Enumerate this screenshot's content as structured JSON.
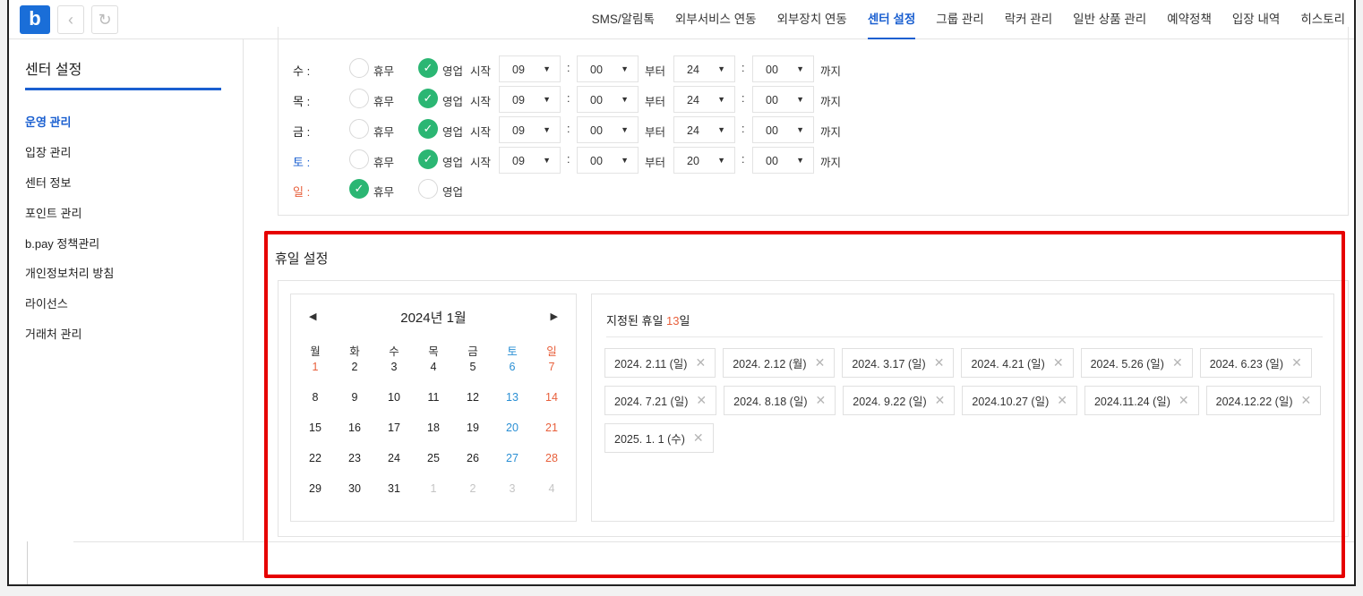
{
  "topbar": {
    "logo": "b",
    "back_icon": "‹",
    "refresh_icon": "↻",
    "menu": [
      {
        "label": "SMS/알림톡",
        "active": false
      },
      {
        "label": "외부서비스 연동",
        "active": false
      },
      {
        "label": "외부장치 연동",
        "active": false
      },
      {
        "label": "센터 설정",
        "active": true
      },
      {
        "label": "그룹 관리",
        "active": false
      },
      {
        "label": "락커 관리",
        "active": false
      },
      {
        "label": "일반 상품 관리",
        "active": false
      },
      {
        "label": "예약정책",
        "active": false
      },
      {
        "label": "입장 내역",
        "active": false
      },
      {
        "label": "히스토리",
        "active": false
      }
    ]
  },
  "sidebar": {
    "title": "센터 설정",
    "items": [
      {
        "label": "운영 관리",
        "active": true
      },
      {
        "label": "입장 관리",
        "active": false
      },
      {
        "label": "센터 정보",
        "active": false
      },
      {
        "label": "포인트 관리",
        "active": false
      },
      {
        "label": "b.pay 정책관리",
        "active": false
      },
      {
        "label": "개인정보처리 방침",
        "active": false
      },
      {
        "label": "라이선스",
        "active": false
      },
      {
        "label": "거래처 관리",
        "active": false
      }
    ]
  },
  "hours": {
    "closed_label": "휴무",
    "open_label": "영업",
    "start_label": "시작",
    "from_label": "부터",
    "until_label": "까지",
    "colon": ":",
    "rows": [
      {
        "day": "수 :",
        "status": "open",
        "start_h": "09",
        "start_m": "00",
        "end_h": "24",
        "end_m": "00"
      },
      {
        "day": "목 :",
        "status": "open",
        "start_h": "09",
        "start_m": "00",
        "end_h": "24",
        "end_m": "00"
      },
      {
        "day": "금 :",
        "status": "open",
        "start_h": "09",
        "start_m": "00",
        "end_h": "24",
        "end_m": "00"
      },
      {
        "day": "토 :",
        "status": "open",
        "start_h": "09",
        "start_m": "00",
        "end_h": "20",
        "end_m": "00"
      },
      {
        "day": "일 :",
        "status": "closed"
      }
    ]
  },
  "holiday": {
    "title": "휴일 설정",
    "calendar": {
      "month_label": "2024년 1월",
      "prev_icon": "◀",
      "next_icon": "▶",
      "weekdays": [
        "월",
        "화",
        "수",
        "목",
        "금",
        "토",
        "일"
      ],
      "weeks": [
        [
          "1",
          "2",
          "3",
          "4",
          "5",
          "6",
          "7"
        ],
        [
          "8",
          "9",
          "10",
          "11",
          "12",
          "13",
          "14"
        ],
        [
          "15",
          "16",
          "17",
          "18",
          "19",
          "20",
          "21"
        ],
        [
          "22",
          "23",
          "24",
          "25",
          "26",
          "27",
          "28"
        ],
        [
          "29",
          "30",
          "31",
          "1",
          "2",
          "3",
          "4"
        ]
      ],
      "red_dates": [
        "1"
      ]
    },
    "list": {
      "title_prefix": "지정된 휴일 ",
      "count": "13",
      "title_suffix": "일",
      "remove_icon": "✕",
      "items": [
        "2024. 2.11 (일)",
        "2024. 2.12 (월)",
        "2024. 3.17 (일)",
        "2024. 4.21 (일)",
        "2024. 5.26 (일)",
        "2024. 6.23 (일)",
        "2024. 7.21 (일)",
        "2024. 8.18 (일)",
        "2024. 9.22 (일)",
        "2024.10.27 (일)",
        "2024.11.24 (일)",
        "2024.12.22 (일)",
        "2025. 1. 1 (수)"
      ]
    }
  },
  "colors": {
    "accent": "#1a5fd0",
    "check": "#2bb673",
    "sunday": "#e8603c",
    "saturday": "#2a8fd4",
    "highlight": "#e60000"
  }
}
